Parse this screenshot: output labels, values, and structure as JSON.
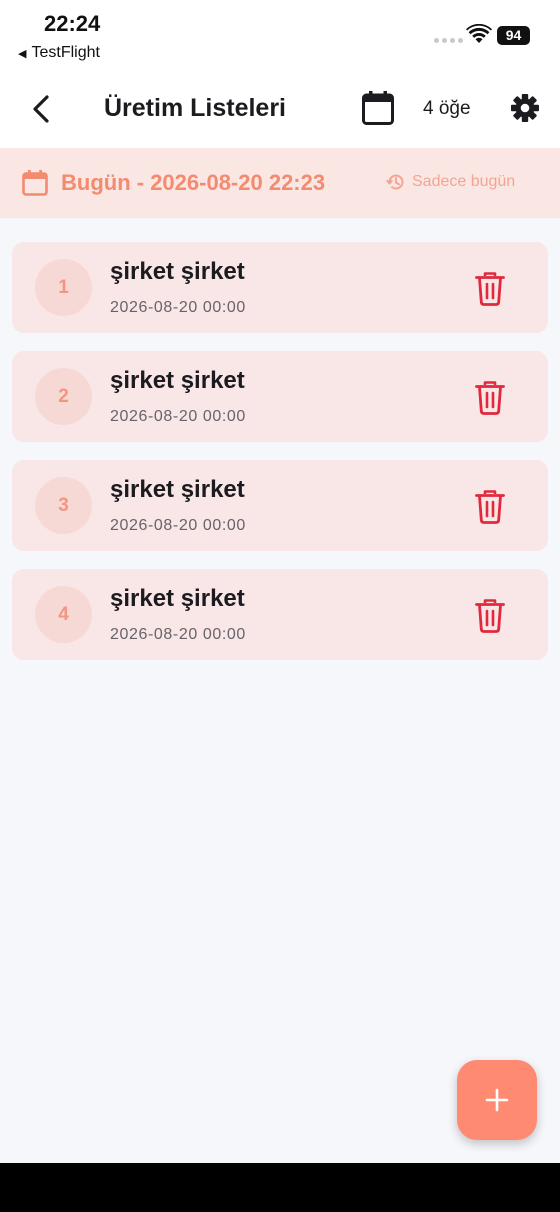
{
  "status_bar": {
    "time": "22:24",
    "back_app": "TestFlight",
    "battery": "94"
  },
  "app_bar": {
    "title": "Üretim Listeleri",
    "item_count": "4 öğe"
  },
  "date_banner": {
    "text": "Bugün - 2026-08-20 22:23",
    "filter_label": "Sadece bugün"
  },
  "items": [
    {
      "index": "1",
      "title": "şirket şirket",
      "date": "2026-08-20 00:00"
    },
    {
      "index": "2",
      "title": "şirket şirket",
      "date": "2026-08-20 00:00"
    },
    {
      "index": "3",
      "title": "şirket şirket",
      "date": "2026-08-20 00:00"
    },
    {
      "index": "4",
      "title": "şirket şirket",
      "date": "2026-08-20 00:00"
    }
  ],
  "icons": {
    "back": "chevron-left-icon",
    "calendar": "calendar-icon",
    "settings": "gear-icon",
    "history": "history-icon",
    "delete": "trash-icon",
    "add": "plus-icon"
  },
  "colors": {
    "accent": "#ff8a72",
    "banner_bg": "#fae6e3",
    "banner_text": "#f28b6f",
    "item_bg": "#f9e6e6",
    "delete_red": "#e0293c"
  }
}
